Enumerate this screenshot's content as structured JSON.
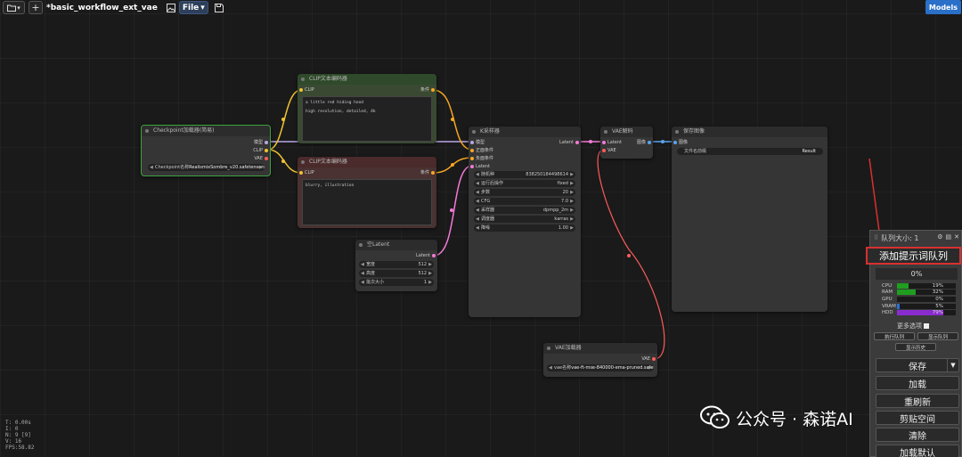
{
  "topbar": {
    "folder_caret": "▾",
    "add_tab": "+",
    "workflow_title": "*basic_workflow_ext_vae",
    "file_menu": "File",
    "file_caret": "▾",
    "models_button": "Models"
  },
  "nodes": {
    "checkpoint": {
      "title": "Checkpoint加载器(简易)",
      "outputs": [
        "模型",
        "CLIP",
        "VAE"
      ],
      "ckpt_label": "Checkpoint名称",
      "ckpt_value": "RealismixSombre_v20.safetensors"
    },
    "clip_pos": {
      "title": "CLIP文本编码器",
      "input": "CLIP",
      "output": "条件",
      "text_lines": [
        "a little red hiding hood",
        "high resolution, detailed, 4k"
      ]
    },
    "clip_neg": {
      "title": "CLIP文本编码器",
      "input": "CLIP",
      "output": "条件",
      "text_lines": [
        "blurry, illustration"
      ]
    },
    "empty_latent": {
      "title": "空Latent",
      "output": "Latent",
      "widgets": [
        {
          "label": "宽度",
          "value": "512"
        },
        {
          "label": "高度",
          "value": "512"
        },
        {
          "label": "批次大小",
          "value": "1"
        }
      ]
    },
    "ksampler": {
      "title": "K采样器",
      "inputs": [
        "模型",
        "正面条件",
        "负面条件",
        "Latent"
      ],
      "output": "Latent",
      "widgets": [
        {
          "label": "随机种",
          "value": "838250184498614"
        },
        {
          "label": "运行后操作",
          "value": "fixed"
        },
        {
          "label": "步数",
          "value": "20"
        },
        {
          "label": "CFG",
          "value": "7.0"
        },
        {
          "label": "采样器",
          "value": "dpmpp_2m"
        },
        {
          "label": "调度器",
          "value": "karras"
        },
        {
          "label": "降噪",
          "value": "1.00"
        }
      ]
    },
    "vae_decode": {
      "title": "VAE解码",
      "inputs": [
        "Latent",
        "VAE"
      ],
      "output": "图像"
    },
    "save_image": {
      "title": "保存图像",
      "input": "图像",
      "prefix_label": "文件名前缀",
      "prefix_value": "Result"
    },
    "vae_loader": {
      "title": "VAE加载器",
      "output": "VAE",
      "vae_label": "vae名称",
      "vae_value": "vae-ft-mse-840000-ema-pruned.safetensors"
    }
  },
  "stats": {
    "lines": [
      "T: 0.00s",
      "I: 0",
      "N: 9 [9]",
      "V: 16",
      "FPS:58.82"
    ]
  },
  "queue_panel": {
    "queue_size": "队列大小: 1",
    "add_to_queue": "添加提示词队列",
    "progress": "0%",
    "resources": [
      {
        "label": "CPU",
        "percent": 19,
        "value": "19%",
        "color": "#1f9e1f"
      },
      {
        "label": "RAM",
        "percent": 32,
        "value": "32%",
        "color": "#1f9e1f"
      },
      {
        "label": "GPU",
        "percent": 0,
        "value": "0%",
        "color": "#1f9e1f"
      },
      {
        "label": "VRAM",
        "percent": 5,
        "value": "5%",
        "color": "#2a6fd6"
      },
      {
        "label": "HDD",
        "percent": 79,
        "value": "79%",
        "color": "#8a2bd0"
      }
    ],
    "more_options": "更多选项",
    "run_queue": "执行队列",
    "show_queue": "显示队列",
    "show_history": "显示历史",
    "save": "保存",
    "load": "加载",
    "refresh": "重刷新",
    "clipspace": "剪贴空间",
    "clear": "清除",
    "load_default": "加载默认"
  },
  "watermark": {
    "text": "公众号 · 森诺AI"
  },
  "colors": {
    "model_link": "#b9a6e6",
    "clip_link": "#f0c330",
    "cond_link": "#f5a623",
    "latent_link": "#f27ad6",
    "vae_link": "#ff5b5b",
    "image_link": "#5aa3f0",
    "red_annotation": "#d83030"
  }
}
